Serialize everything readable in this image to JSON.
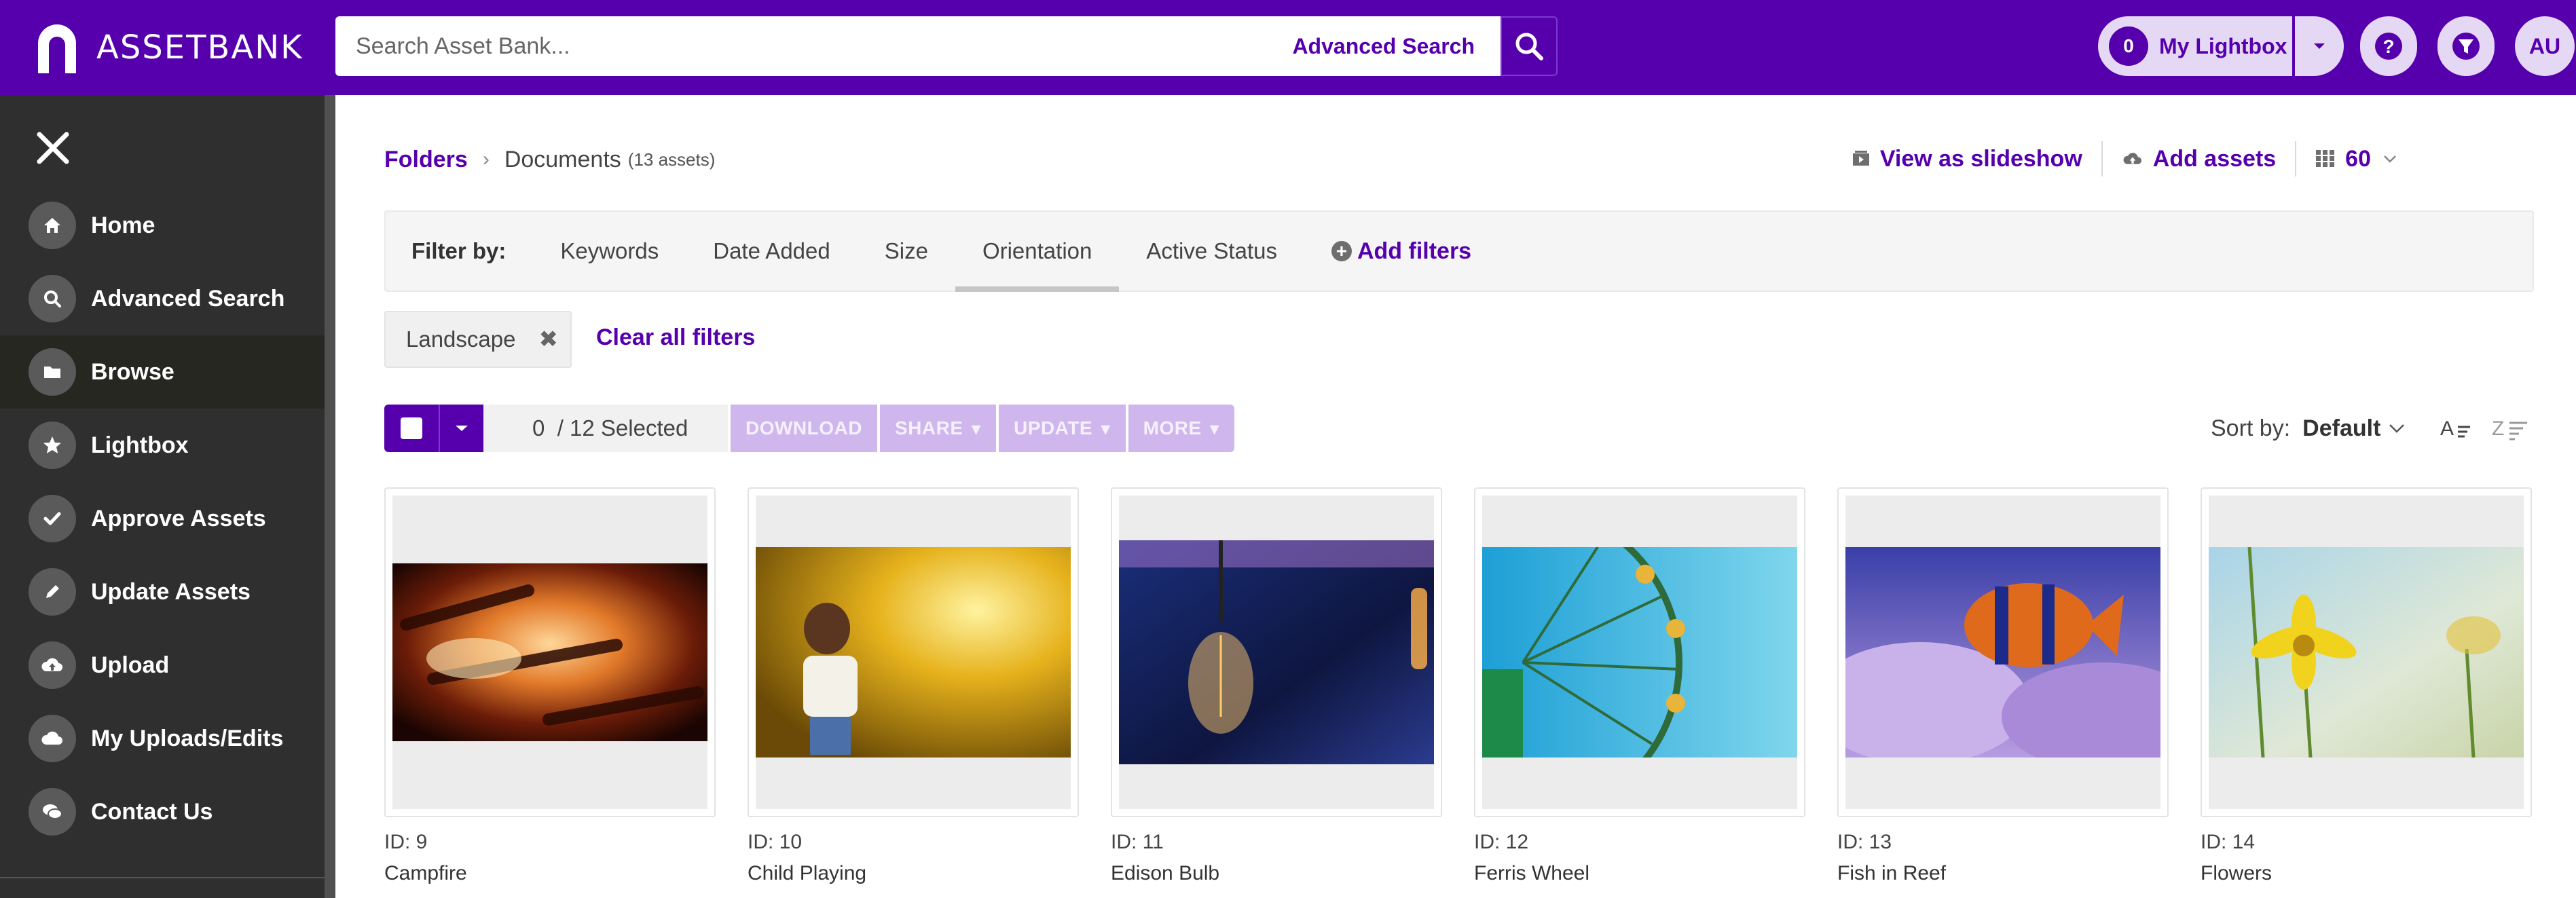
{
  "app": {
    "logo_text": "ASSETBANK",
    "brand_color": "#5600ad"
  },
  "header": {
    "search_placeholder": "Search Asset Bank...",
    "advanced_search_label": "Advanced Search",
    "lightbox_count": "0",
    "lightbox_label": "My Lightbox",
    "user_initials": "AU",
    "icons": [
      "search-icon",
      "help-icon",
      "filter-icon",
      "caret-down-icon"
    ]
  },
  "sidebar": {
    "items": [
      {
        "label": "Home",
        "icon": "home-icon"
      },
      {
        "label": "Advanced Search",
        "icon": "search-icon"
      },
      {
        "label": "Browse",
        "icon": "folder-icon",
        "active": true
      },
      {
        "label": "Lightbox",
        "icon": "star-icon"
      },
      {
        "label": "Approve Assets",
        "icon": "check-icon"
      },
      {
        "label": "Update Assets",
        "icon": "pencil-icon"
      },
      {
        "label": "Upload",
        "icon": "cloud-upload-icon"
      },
      {
        "label": "My Uploads/Edits",
        "icon": "cloud-icon"
      },
      {
        "label": "Contact Us",
        "icon": "chat-icon"
      }
    ]
  },
  "breadcrumb": {
    "root": "Folders",
    "current": "Documents",
    "count": "(13 assets)"
  },
  "actions": {
    "slideshow": "View as slideshow",
    "add_assets": "Add assets",
    "page_size": "60"
  },
  "filters": {
    "label": "Filter by:",
    "tabs": [
      "Keywords",
      "Date Added",
      "Size",
      "Orientation",
      "Active Status"
    ],
    "active_tab": "Orientation",
    "add_filters": "Add filters",
    "active_chip": "Landscape",
    "clear_all": "Clear all filters"
  },
  "toolbar": {
    "selected_count": "0",
    "selected_suffix": "/ 12 Selected",
    "download": "DOWNLOAD",
    "share": "SHARE",
    "update": "UPDATE",
    "more": "MORE"
  },
  "sort": {
    "label": "Sort by:",
    "value": "Default"
  },
  "assets": [
    {
      "id": "ID: 9",
      "title": "Campfire",
      "image": "campfire"
    },
    {
      "id": "ID: 10",
      "title": "Child Playing",
      "image": "child-playing"
    },
    {
      "id": "ID: 11",
      "title": "Edison Bulb",
      "image": "edison-bulb"
    },
    {
      "id": "ID: 12",
      "title": "Ferris Wheel",
      "image": "ferris-wheel"
    },
    {
      "id": "ID: 13",
      "title": "Fish in Reef",
      "image": "fish-in-reef"
    },
    {
      "id": "ID: 14",
      "title": "Flowers",
      "image": "flowers"
    }
  ]
}
